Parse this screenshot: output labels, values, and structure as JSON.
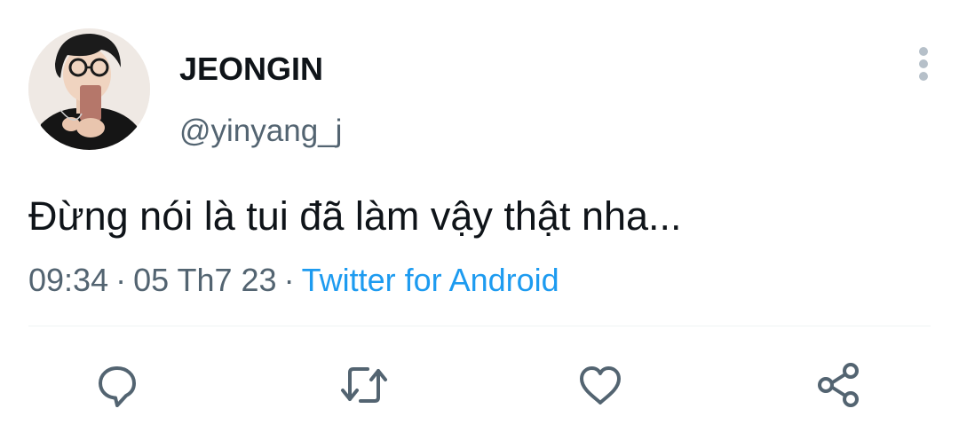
{
  "author": {
    "display_name": "JEONGIN",
    "handle": "@yinyang_j",
    "avatar_icon": "profile-photo"
  },
  "tweet": {
    "text": "Đừng nói là tui đã làm vậy thật nha...",
    "time": "09:34",
    "date": "05 Th7 23",
    "separator": "·",
    "source": "Twitter for Android"
  },
  "actions": [
    {
      "name": "reply",
      "icon": "chat-bubble-icon"
    },
    {
      "name": "retweet",
      "icon": "retweet-icon"
    },
    {
      "name": "like",
      "icon": "heart-icon"
    },
    {
      "name": "share",
      "icon": "share-icon"
    }
  ],
  "colors": {
    "text_primary": "#0f1419",
    "text_secondary": "#536471",
    "link": "#1d9bf0",
    "icon": "#536471",
    "divider": "#eff3f4"
  }
}
